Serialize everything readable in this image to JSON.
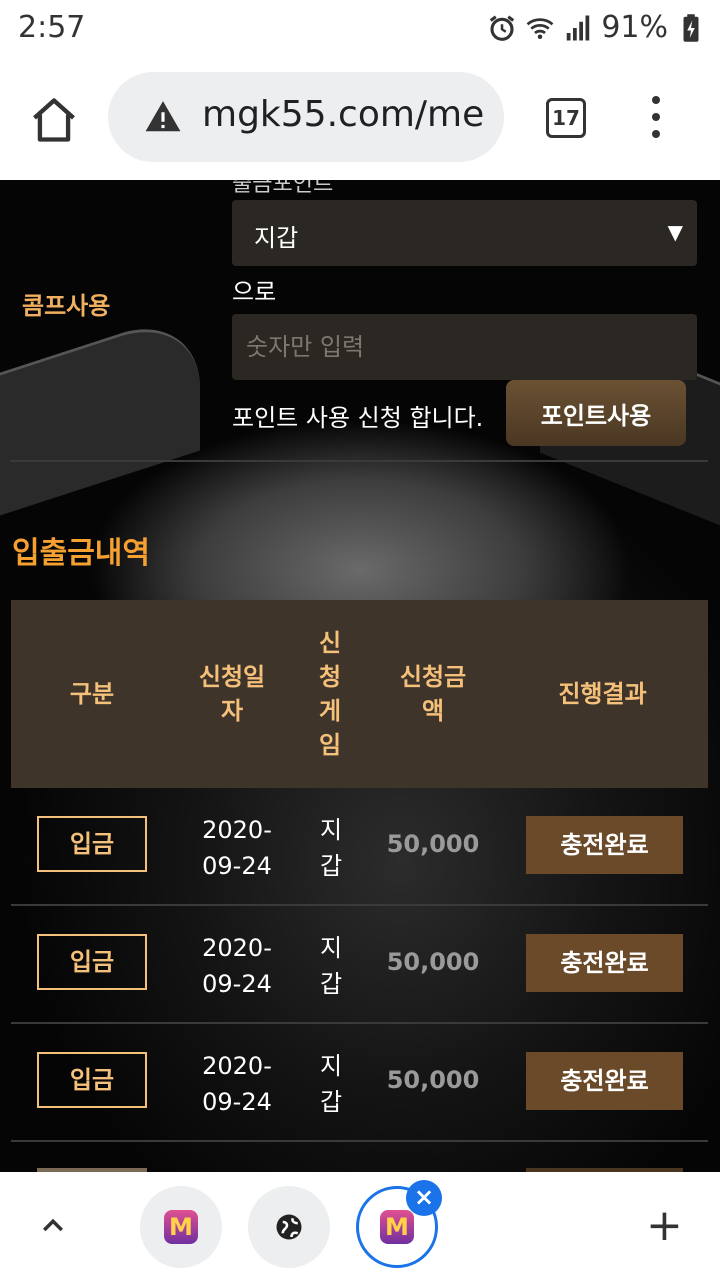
{
  "status_bar": {
    "time": "2:57",
    "battery": "91%"
  },
  "browser": {
    "url_main": "mgk55.com/me",
    "tab_count": "17"
  },
  "comp_form": {
    "cut_label": "출금포인트",
    "section_label": "콤프사용",
    "wallet_select": "지갑",
    "connector": "으로",
    "amount_placeholder": "숫자만 입력",
    "apply_text": "포인트 사용 신청 합니다.",
    "submit_label": "포인트사용"
  },
  "history": {
    "title": "입출금내역",
    "headers": {
      "type": "구분",
      "date": "신청일\n자",
      "game": "신\n청\n게\n임",
      "amount": "신청금\n액",
      "result": "진행결과"
    },
    "rows": [
      {
        "type": "입금",
        "date": "2020-\n09-24",
        "game": "지\n갑",
        "amount": "50,000",
        "result": "충전완료"
      },
      {
        "type": "입금",
        "date": "2020-\n09-24",
        "game": "지\n갑",
        "amount": "50,000",
        "result": "충전완료"
      },
      {
        "type": "입금",
        "date": "2020-\n09-24",
        "game": "지\n갑",
        "amount": "50,000",
        "result": "충전완료"
      }
    ]
  },
  "tab_strip": {
    "tab_logo": "M"
  },
  "colors": {
    "accent_orange": "#f5a030",
    "header_bg": "#3e342a",
    "status_brown": "#6b4a2a",
    "chrome_blue": "#1a73e8"
  }
}
